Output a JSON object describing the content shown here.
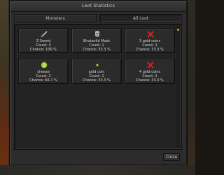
{
  "window": {
    "title": "Loot Statistics"
  },
  "tabs": [
    {
      "label": "Monsters",
      "active": false
    },
    {
      "label": "All Loot",
      "active": true
    }
  ],
  "items": [
    {
      "name": "Z-Sword",
      "count": "Count: 3",
      "chance": "Chance: 100 %",
      "icon": "sword-icon"
    },
    {
      "name": "Bhutsuful Mask",
      "count": "Count: 1",
      "chance": "Chance: 33.3 %",
      "icon": "mask-icon"
    },
    {
      "name": "3 gold coins",
      "count": "Count: 1",
      "chance": "Chance: 33.3 %",
      "icon": "missing-x-icon"
    },
    {
      "name": "cheese",
      "count": "Count: 2",
      "chance": "Chance: 66.7 %",
      "icon": "cheese-icon"
    },
    {
      "name": "gold coin",
      "count": "Count: 1",
      "chance": "Chance: 33.3 %",
      "icon": "gold-coin-icon"
    },
    {
      "name": "4 gold coins",
      "count": "Count: 1",
      "chance": "Chance: 33.3 %",
      "icon": "missing-x-icon"
    }
  ],
  "buttons": {
    "close_label": "Close"
  },
  "colors": {
    "panel_bg": "#232323",
    "text": "#d6d6d6",
    "missing_red": "#d42020",
    "gold": "#e0b020"
  }
}
